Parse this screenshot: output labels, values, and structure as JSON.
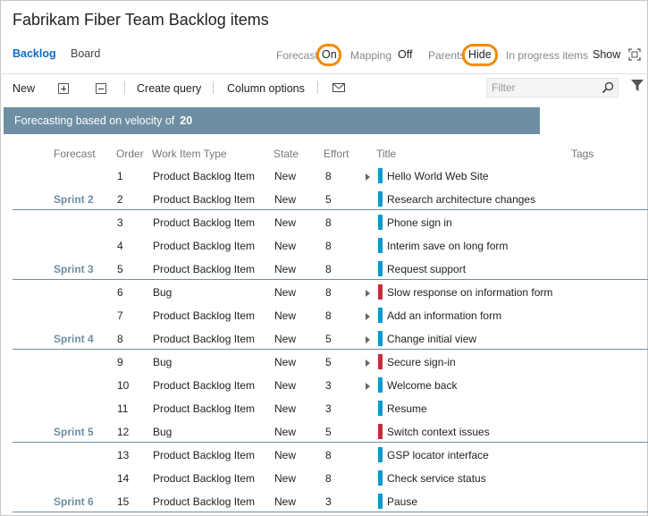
{
  "page": {
    "title": "Fabrikam Fiber Team Backlog items"
  },
  "nav": {
    "backlog": "Backlog",
    "board": "Board"
  },
  "options": {
    "forecast_label": "Forecast",
    "forecast_value": "On",
    "mapping_label": "Mapping",
    "mapping_value": "Off",
    "parents_label": "Parents",
    "parents_value": "Hide",
    "inprogress_label": "In progress items",
    "inprogress_value": "Show"
  },
  "toolbar": {
    "new_label": "New",
    "create_query_label": "Create query",
    "column_options_label": "Column options",
    "filter_placeholder": "Filter"
  },
  "banner": {
    "text": "Forecasting based on velocity of",
    "velocity": "20"
  },
  "columns": {
    "forecast": "Forecast",
    "order": "Order",
    "work_item_type": "Work Item Type",
    "state": "State",
    "effort": "Effort",
    "title": "Title",
    "tags": "Tags"
  },
  "colors": {
    "pbi": "#009ccc",
    "bug": "#cc293d",
    "sprint": "#6e8ea3",
    "accent": "#106ebe",
    "highlight": "#f28a00"
  },
  "rows": [
    {
      "order": "1",
      "type": "Product Backlog Item",
      "state": "New",
      "effort": "8",
      "title": "Hello World Web Site",
      "expandable": true,
      "kind": "pbi"
    },
    {
      "order": "2",
      "type": "Product Backlog Item",
      "state": "New",
      "effort": "5",
      "title": "Research architecture changes",
      "expandable": false,
      "kind": "pbi"
    },
    {
      "order": "3",
      "type": "Product Backlog Item",
      "state": "New",
      "effort": "8",
      "title": "Phone sign in",
      "expandable": false,
      "kind": "pbi"
    },
    {
      "order": "4",
      "type": "Product Backlog Item",
      "state": "New",
      "effort": "8",
      "title": "Interim save on long form",
      "expandable": false,
      "kind": "pbi"
    },
    {
      "order": "5",
      "type": "Product Backlog Item",
      "state": "New",
      "effort": "8",
      "title": "Request support",
      "expandable": false,
      "kind": "pbi"
    },
    {
      "order": "6",
      "type": "Bug",
      "state": "New",
      "effort": "8",
      "title": "Slow response on information form",
      "expandable": true,
      "kind": "bug"
    },
    {
      "order": "7",
      "type": "Product Backlog Item",
      "state": "New",
      "effort": "8",
      "title": "Add an information form",
      "expandable": true,
      "kind": "pbi"
    },
    {
      "order": "8",
      "type": "Product Backlog Item",
      "state": "New",
      "effort": "5",
      "title": "Change initial view",
      "expandable": true,
      "kind": "pbi"
    },
    {
      "order": "9",
      "type": "Bug",
      "state": "New",
      "effort": "5",
      "title": "Secure sign-in",
      "expandable": true,
      "kind": "bug"
    },
    {
      "order": "10",
      "type": "Product Backlog Item",
      "state": "New",
      "effort": "3",
      "title": "Welcome back",
      "expandable": true,
      "kind": "pbi"
    },
    {
      "order": "11",
      "type": "Product Backlog Item",
      "state": "New",
      "effort": "3",
      "title": "Resume",
      "expandable": false,
      "kind": "pbi"
    },
    {
      "order": "12",
      "type": "Bug",
      "state": "New",
      "effort": "5",
      "title": "Switch context issues",
      "expandable": false,
      "kind": "bug"
    },
    {
      "order": "13",
      "type": "Product Backlog Item",
      "state": "New",
      "effort": "8",
      "title": "GSP locator interface",
      "expandable": false,
      "kind": "pbi"
    },
    {
      "order": "14",
      "type": "Product Backlog Item",
      "state": "New",
      "effort": "8",
      "title": "Check service status",
      "expandable": false,
      "kind": "pbi"
    },
    {
      "order": "15",
      "type": "Product Backlog Item",
      "state": "New",
      "effort": "3",
      "title": "Pause",
      "expandable": false,
      "kind": "pbi"
    }
  ],
  "sprints": [
    {
      "label": "Sprint 2",
      "after_order": "2"
    },
    {
      "label": "Sprint 3",
      "after_order": "5"
    },
    {
      "label": "Sprint 4",
      "after_order": "8"
    },
    {
      "label": "Sprint 5",
      "after_order": "12"
    },
    {
      "label": "Sprint 6",
      "after_order": "15"
    }
  ]
}
